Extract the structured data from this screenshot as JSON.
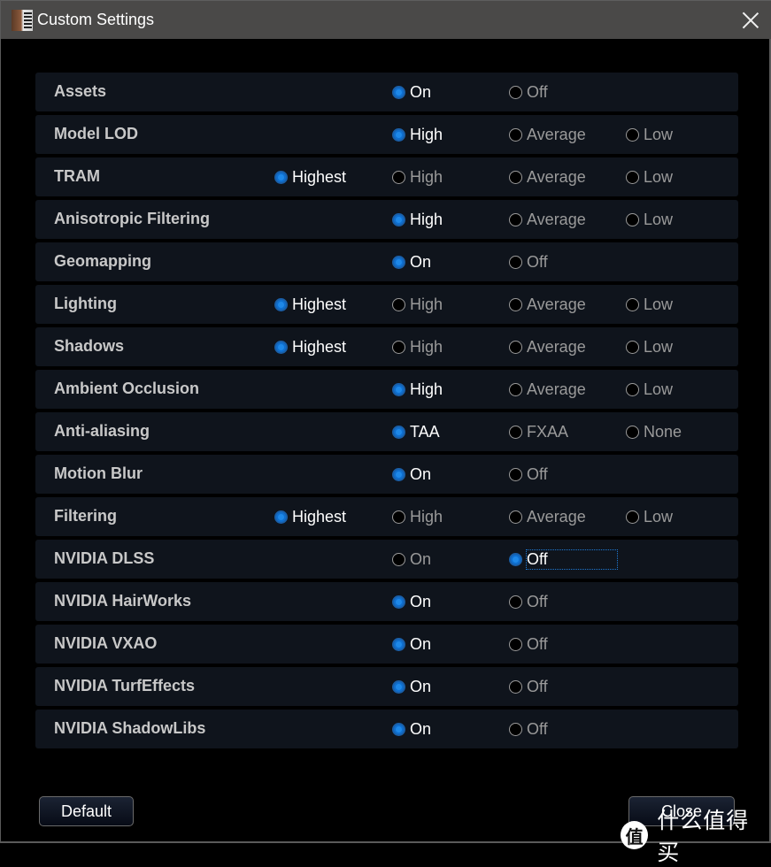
{
  "window": {
    "title": "Custom Settings",
    "icon": "app-icon",
    "close_icon": "close-icon"
  },
  "rows": [
    {
      "label": "Assets",
      "options": [
        {
          "col": 1,
          "label": "On"
        },
        {
          "col": 2,
          "label": "Off"
        }
      ],
      "selected": "On"
    },
    {
      "label": "Model LOD",
      "options": [
        {
          "col": 1,
          "label": "High"
        },
        {
          "col": 2,
          "label": "Average"
        },
        {
          "col": 3,
          "label": "Low"
        }
      ],
      "selected": "High"
    },
    {
      "label": "TRAM",
      "options": [
        {
          "col": 0,
          "label": "Highest"
        },
        {
          "col": 1,
          "label": "High"
        },
        {
          "col": 2,
          "label": "Average"
        },
        {
          "col": 3,
          "label": "Low"
        }
      ],
      "selected": "Highest"
    },
    {
      "label": "Anisotropic Filtering",
      "options": [
        {
          "col": 1,
          "label": "High"
        },
        {
          "col": 2,
          "label": "Average"
        },
        {
          "col": 3,
          "label": "Low"
        }
      ],
      "selected": "High"
    },
    {
      "label": "Geomapping",
      "options": [
        {
          "col": 1,
          "label": "On"
        },
        {
          "col": 2,
          "label": "Off"
        }
      ],
      "selected": "On"
    },
    {
      "label": "Lighting",
      "options": [
        {
          "col": 0,
          "label": "Highest"
        },
        {
          "col": 1,
          "label": "High"
        },
        {
          "col": 2,
          "label": "Average"
        },
        {
          "col": 3,
          "label": "Low"
        }
      ],
      "selected": "Highest"
    },
    {
      "label": "Shadows",
      "options": [
        {
          "col": 0,
          "label": "Highest"
        },
        {
          "col": 1,
          "label": "High"
        },
        {
          "col": 2,
          "label": "Average"
        },
        {
          "col": 3,
          "label": "Low"
        }
      ],
      "selected": "Highest"
    },
    {
      "label": "Ambient Occlusion",
      "options": [
        {
          "col": 1,
          "label": "High"
        },
        {
          "col": 2,
          "label": "Average"
        },
        {
          "col": 3,
          "label": "Low"
        }
      ],
      "selected": "High"
    },
    {
      "label": "Anti-aliasing",
      "options": [
        {
          "col": 1,
          "label": "TAA"
        },
        {
          "col": 2,
          "label": "FXAA"
        },
        {
          "col": 3,
          "label": "None"
        }
      ],
      "selected": "TAA"
    },
    {
      "label": "Motion Blur",
      "options": [
        {
          "col": 1,
          "label": "On"
        },
        {
          "col": 2,
          "label": "Off"
        }
      ],
      "selected": "On"
    },
    {
      "label": "Filtering",
      "options": [
        {
          "col": 0,
          "label": "Highest"
        },
        {
          "col": 1,
          "label": "High"
        },
        {
          "col": 2,
          "label": "Average"
        },
        {
          "col": 3,
          "label": "Low"
        }
      ],
      "selected": "Highest"
    },
    {
      "label": "NVIDIA DLSS",
      "options": [
        {
          "col": 1,
          "label": "On"
        },
        {
          "col": 2,
          "label": "Off"
        }
      ],
      "selected": "Off",
      "focused": "Off"
    },
    {
      "label": "NVIDIA HairWorks",
      "options": [
        {
          "col": 1,
          "label": "On"
        },
        {
          "col": 2,
          "label": "Off"
        }
      ],
      "selected": "On"
    },
    {
      "label": "NVIDIA VXAO",
      "options": [
        {
          "col": 1,
          "label": "On"
        },
        {
          "col": 2,
          "label": "Off"
        }
      ],
      "selected": "On"
    },
    {
      "label": "NVIDIA TurfEffects",
      "options": [
        {
          "col": 1,
          "label": "On"
        },
        {
          "col": 2,
          "label": "Off"
        }
      ],
      "selected": "On"
    },
    {
      "label": "NVIDIA ShadowLibs",
      "options": [
        {
          "col": 1,
          "label": "On"
        },
        {
          "col": 2,
          "label": "Off"
        }
      ],
      "selected": "On"
    }
  ],
  "buttons": {
    "default_label": "Default",
    "close_label": "Close"
  },
  "watermark": {
    "logo_char": "值",
    "text": "什么值得买"
  },
  "colors": {
    "accent": "#0f6fcf",
    "row_bg": "#0f141c",
    "titlebar": "#4a4948"
  }
}
